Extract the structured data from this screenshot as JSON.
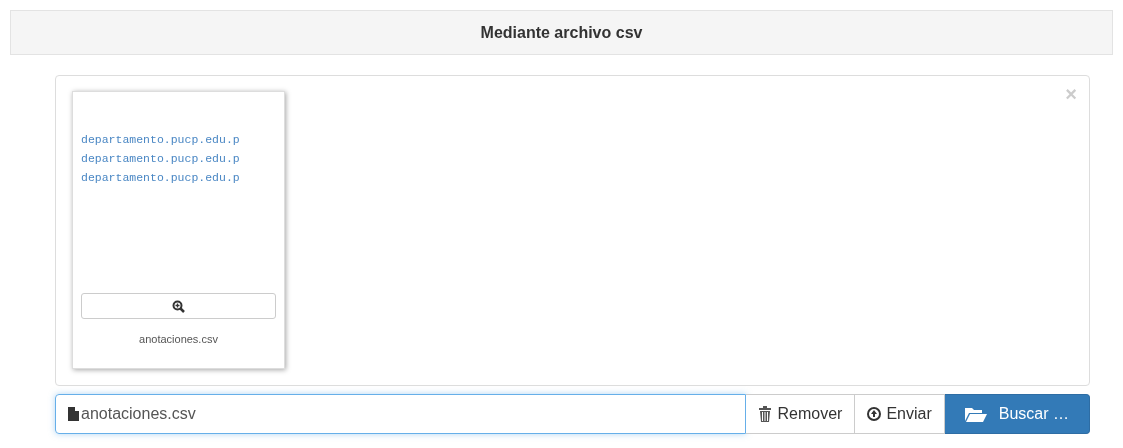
{
  "panel": {
    "title": "Mediante archivo csv"
  },
  "preview": {
    "close": "×",
    "files": [
      {
        "lines": [
          "departamento.pucp.edu.p",
          "departamento.pucp.edu.p",
          "departamento.pucp.edu.p"
        ],
        "name": "anotaciones.csv"
      }
    ]
  },
  "input": {
    "value": "anotaciones.csv"
  },
  "buttons": [
    {
      "kind": "remove",
      "label": "Remover"
    },
    {
      "kind": "upload",
      "label": "Enviar"
    },
    {
      "kind": "browse",
      "label": "Buscar …"
    }
  ]
}
